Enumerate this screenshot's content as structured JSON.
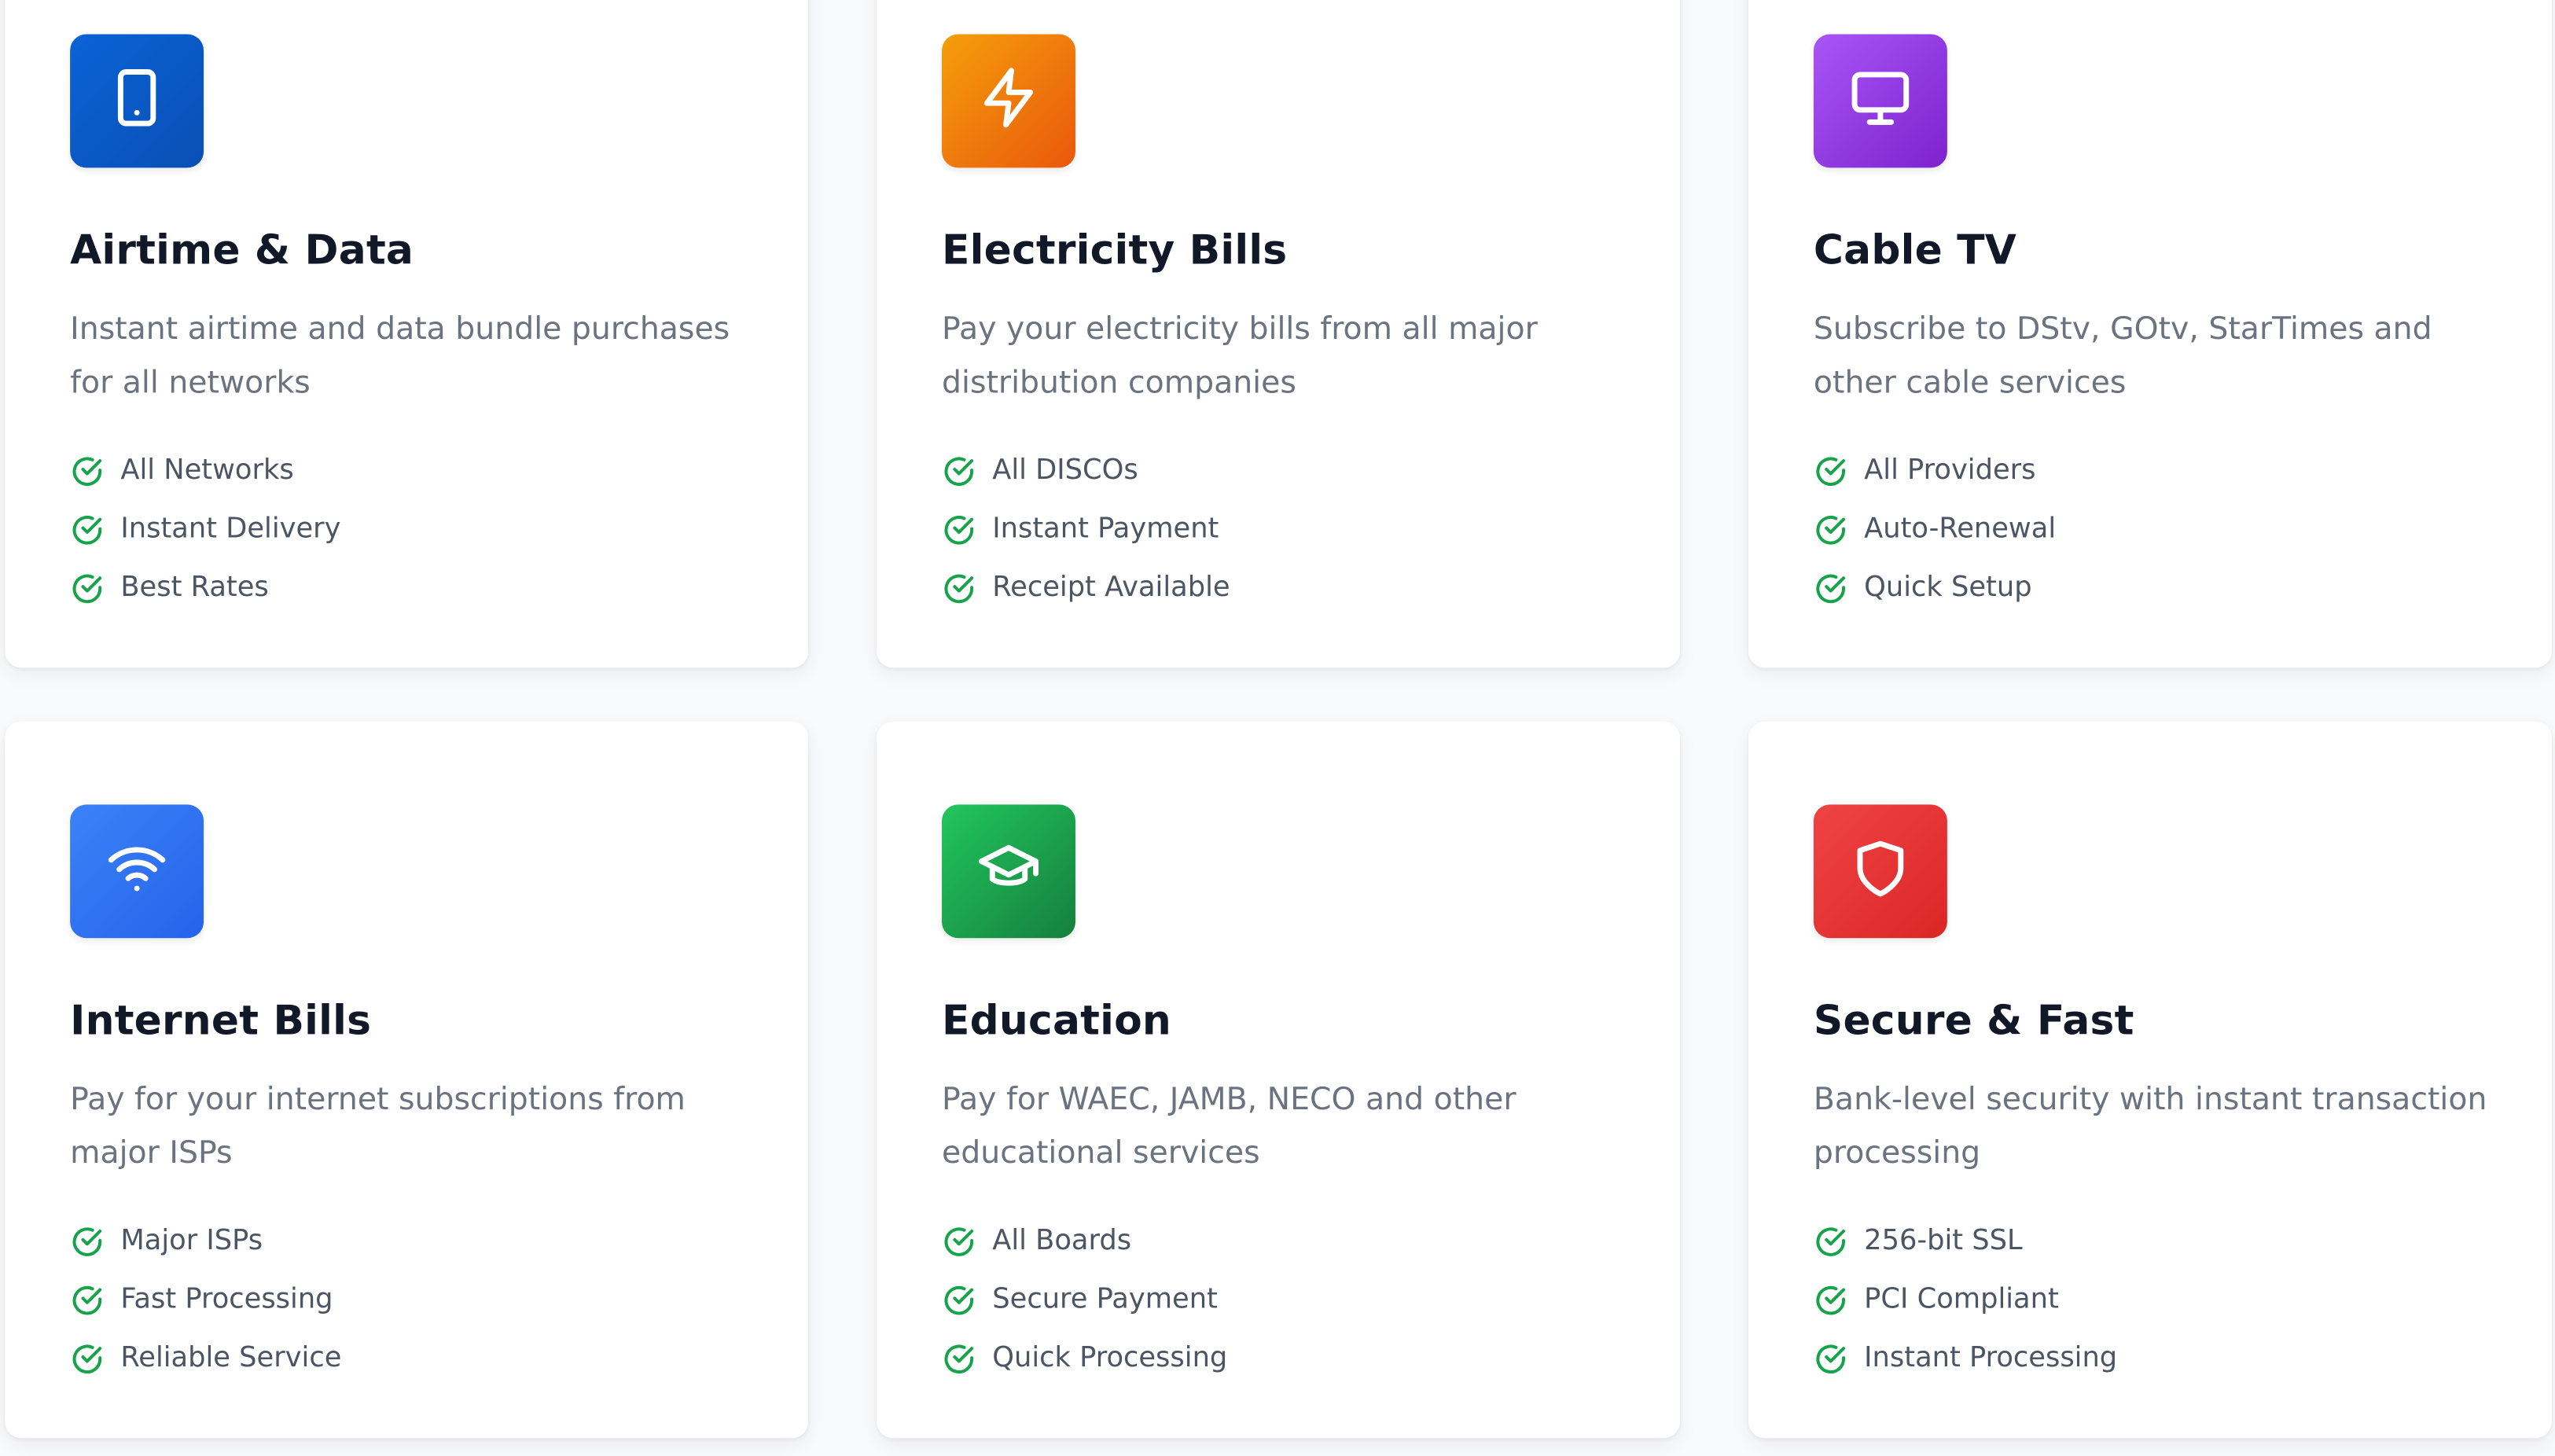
{
  "colors": {
    "airtime": "#0b57c9",
    "electricity": "#f26b0f",
    "cable": "#9334e9",
    "internet": "#2f6bf0",
    "education": "#17a34a",
    "secure": "#e0262c",
    "check": "#16a34a"
  },
  "services": [
    {
      "icon": "smartphone-icon",
      "title": "Airtime & Data",
      "description": "Instant airtime and data bundle purchases for all networks",
      "features": [
        "All Networks",
        "Instant Delivery",
        "Best Rates"
      ]
    },
    {
      "icon": "lightning-icon",
      "title": "Electricity Bills",
      "description": "Pay your electricity bills from all major distribution companies",
      "features": [
        "All DISCOs",
        "Instant Payment",
        "Receipt Available"
      ]
    },
    {
      "icon": "monitor-icon",
      "title": "Cable TV",
      "description": "Subscribe to DStv, GOtv, StarTimes and other cable services",
      "features": [
        "All Providers",
        "Auto-Renewal",
        "Quick Setup"
      ]
    },
    {
      "icon": "wifi-icon",
      "title": "Internet Bills",
      "description": "Pay for your internet subscriptions from major ISPs",
      "features": [
        "Major ISPs",
        "Fast Processing",
        "Reliable Service"
      ]
    },
    {
      "icon": "graduation-cap-icon",
      "title": "Education",
      "description": "Pay for WAEC, JAMB, NECO and other educational services",
      "features": [
        "All Boards",
        "Secure Payment",
        "Quick Processing"
      ]
    },
    {
      "icon": "shield-icon",
      "title": "Secure & Fast",
      "description": "Bank-level security with instant transaction processing",
      "features": [
        "256-bit SSL",
        "PCI Compliant",
        "Instant Processing"
      ]
    }
  ]
}
